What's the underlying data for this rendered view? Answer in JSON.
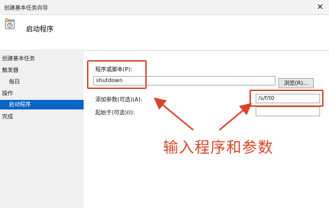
{
  "window": {
    "title": "创建基本任务向导",
    "close_glyph": "✕"
  },
  "header": {
    "title": "启动程序",
    "icon": "task-wizard-icon"
  },
  "sidebar": {
    "items": [
      {
        "label": "创建基本任务"
      },
      {
        "label": "触发器"
      },
      {
        "label": "每日"
      },
      {
        "label": "操作"
      },
      {
        "label": "启动程序",
        "active": true
      },
      {
        "label": "完成"
      }
    ]
  },
  "form": {
    "program_label": "程序或脚本(P):",
    "program_value": "shutdown",
    "browse_label": "浏览(R)...",
    "args_label": "添加参数(可选)(A):",
    "args_value": "/s/f/t0",
    "start_in_label": "起始于(可选)(I):",
    "start_in_value": ""
  },
  "annotation": {
    "text": "输入程序和参数",
    "color": "#d8452b"
  },
  "colors": {
    "accent": "#0a64c9",
    "highlight": "#d8452b",
    "sidebar_bg": "#f0f0f0"
  }
}
